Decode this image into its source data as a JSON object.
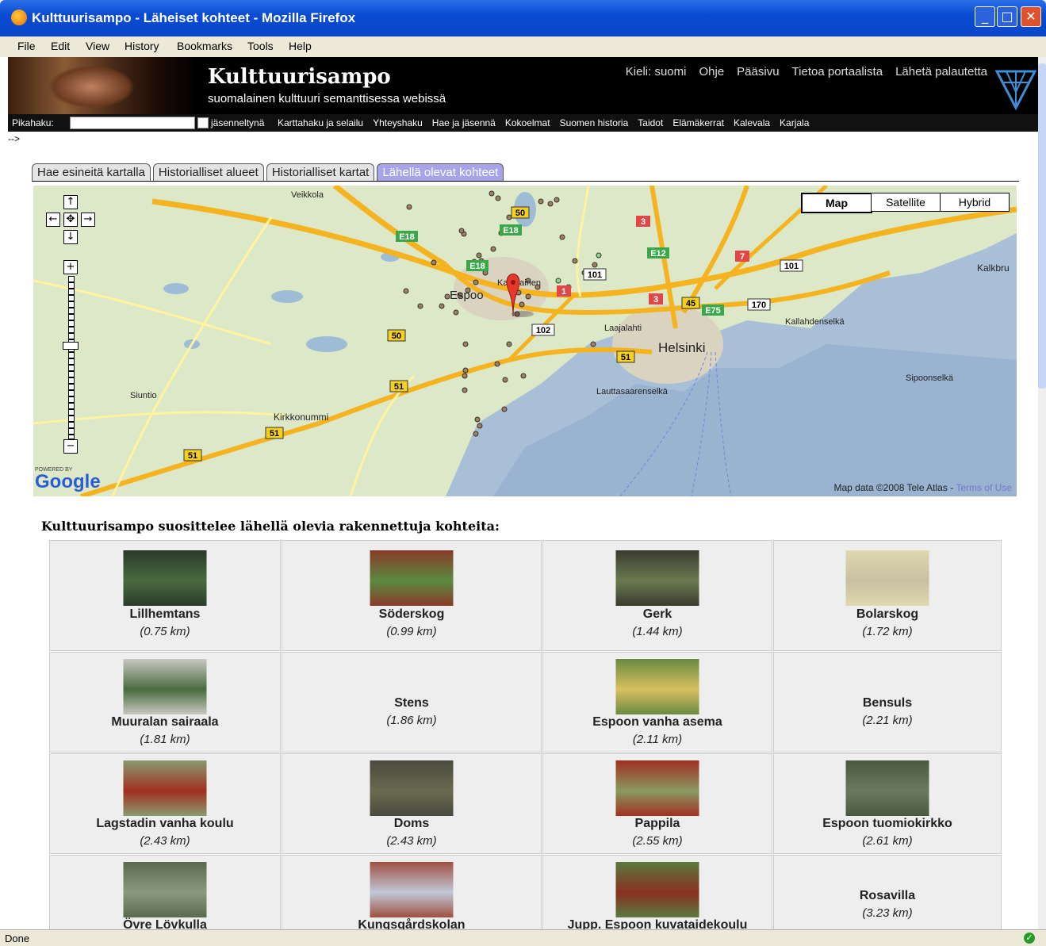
{
  "window": {
    "title": "Kulttuurisampo - Läheiset kohteet - Mozilla Firefox"
  },
  "menu": [
    "File",
    "Edit",
    "View",
    "History",
    "Bookmarks",
    "Tools",
    "Help"
  ],
  "header": {
    "brand": "Kulttuurisampo",
    "tagline": "suomalainen kulttuuri semanttisessa webissä",
    "links": [
      "Kieli: suomi",
      "Ohje",
      "Pääsivu",
      "Tietoa portaalista",
      "Lähetä palautetta"
    ]
  },
  "nav": {
    "search_label": "Pikahaku:",
    "search_value": "",
    "checkbox_label": "jäsenneltynä",
    "links": [
      "Karttahaku ja selailu",
      "Yhteyshaku",
      "Hae ja jäsennä",
      "Kokoelmat",
      "Suomen historia",
      "Taidot",
      "Elämäkerrat",
      "Kalevala",
      "Karjala"
    ]
  },
  "stray_text": "-->",
  "tabs": [
    "Hae esineitä kartalla",
    "Historialliset alueet",
    "Historialliset kartat",
    "Lähellä olevat kohteet"
  ],
  "active_tab": 3,
  "map": {
    "types": [
      "Map",
      "Satellite",
      "Hybrid"
    ],
    "active_type": "Map",
    "credit": "Map data ©2008 Tele Atlas -",
    "terms": "Terms of Use",
    "powered_by": "POWERED BY",
    "google": "Google",
    "places": [
      "Veikkola",
      "Espoo",
      "Kauniainen",
      "Laajalahti",
      "Helsinki",
      "Kallahdenselkä",
      "Sipoonselkä",
      "Lauttasaarenselkä",
      "Siuntio",
      "Kirkkonummi",
      "Kalkbru"
    ],
    "roads": [
      "E18",
      "E18",
      "E18",
      "50",
      "50",
      "51",
      "51",
      "51",
      "51",
      "E12",
      "3",
      "3",
      "7",
      "101",
      "101",
      "1",
      "102",
      "45",
      "E75",
      "170"
    ]
  },
  "recommend": {
    "title": "Kulttuurisampo suosittelee lähellä olevia rakennettuja kohteita:",
    "items": [
      {
        "name": "Lillhemtans",
        "dist": "(0.75 km)"
      },
      {
        "name": "Söderskog",
        "dist": "(0.99 km)"
      },
      {
        "name": "Gerk",
        "dist": "(1.44 km)"
      },
      {
        "name": "Bolarskog",
        "dist": "(1.72 km)"
      },
      {
        "name": "Muuralan sairaala",
        "dist": "(1.81 km)"
      },
      {
        "name": "Stens",
        "dist": "(1.86 km)"
      },
      {
        "name": "Espoon vanha asema",
        "dist": "(2.11 km)"
      },
      {
        "name": "Bensuls",
        "dist": "(2.21 km)"
      },
      {
        "name": "Lagstadin vanha koulu",
        "dist": "(2.43 km)"
      },
      {
        "name": "Doms",
        "dist": "(2.43 km)"
      },
      {
        "name": "Pappila",
        "dist": "(2.55 km)"
      },
      {
        "name": "Espoon tuomiokirkko",
        "dist": "(2.61 km)"
      },
      {
        "name": "Övre Lövkulla",
        "dist": ""
      },
      {
        "name": "Kungsgårdskolan",
        "dist": ""
      },
      {
        "name": "Jupp. Espoon kuvataidekoulu",
        "dist": ""
      },
      {
        "name": "Rosavilla",
        "dist": "(3.23 km)"
      }
    ]
  },
  "status": {
    "text": "Done"
  }
}
